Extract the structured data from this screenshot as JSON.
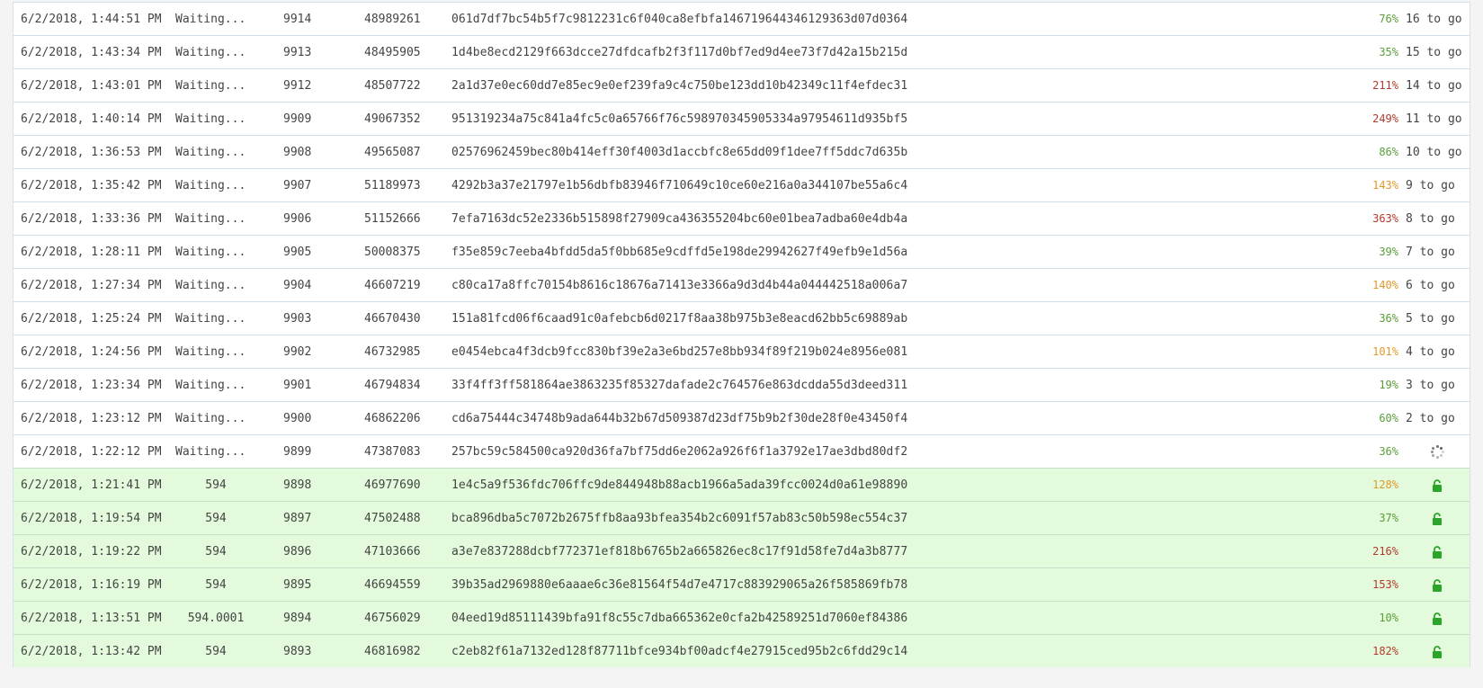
{
  "rows": [
    {
      "time": "6/2/2018, 1:44:51 PM",
      "status": "Waiting...",
      "height": "9914",
      "difficulty": "48989261",
      "hash": "061d7df7bc54b5f7c9812231c6f040ca8efbfa146719644346129363d07d0364",
      "effort": "76%",
      "effort_level": "green",
      "eta": "16 to go",
      "state": "waiting"
    },
    {
      "time": "6/2/2018, 1:43:34 PM",
      "status": "Waiting...",
      "height": "9913",
      "difficulty": "48495905",
      "hash": "1d4be8ecd2129f663dcce27dfdcafb2f3f117d0bf7ed9d4ee73f7d42a15b215d",
      "effort": "35%",
      "effort_level": "green",
      "eta": "15 to go",
      "state": "waiting"
    },
    {
      "time": "6/2/2018, 1:43:01 PM",
      "status": "Waiting...",
      "height": "9912",
      "difficulty": "48507722",
      "hash": "2a1d37e0ec60dd7e85ec9e0ef239fa9c4c750be123dd10b42349c11f4efdec31",
      "effort": "211%",
      "effort_level": "red",
      "eta": "14 to go",
      "state": "waiting"
    },
    {
      "time": "6/2/2018, 1:40:14 PM",
      "status": "Waiting...",
      "height": "9909",
      "difficulty": "49067352",
      "hash": "951319234a75c841a4fc5c0a65766f76c598970345905334a97954611d935bf5",
      "effort": "249%",
      "effort_level": "red",
      "eta": "11 to go",
      "state": "waiting"
    },
    {
      "time": "6/2/2018, 1:36:53 PM",
      "status": "Waiting...",
      "height": "9908",
      "difficulty": "49565087",
      "hash": "02576962459bec80b414eff30f4003d1accbfc8e65dd09f1dee7ff5ddc7d635b",
      "effort": "86%",
      "effort_level": "green",
      "eta": "10 to go",
      "state": "waiting"
    },
    {
      "time": "6/2/2018, 1:35:42 PM",
      "status": "Waiting...",
      "height": "9907",
      "difficulty": "51189973",
      "hash": "4292b3a37e21797e1b56dbfb83946f710649c10ce60e216a0a344107be55a6c4",
      "effort": "143%",
      "effort_level": "orange",
      "eta": "9 to go",
      "state": "waiting"
    },
    {
      "time": "6/2/2018, 1:33:36 PM",
      "status": "Waiting...",
      "height": "9906",
      "difficulty": "51152666",
      "hash": "7efa7163dc52e2336b515898f27909ca436355204bc60e01bea7adba60e4db4a",
      "effort": "363%",
      "effort_level": "red",
      "eta": "8 to go",
      "state": "waiting"
    },
    {
      "time": "6/2/2018, 1:28:11 PM",
      "status": "Waiting...",
      "height": "9905",
      "difficulty": "50008375",
      "hash": "f35e859c7eeba4bfdd5da5f0bb685e9cdffd5e198de29942627f49efb9e1d56a",
      "effort": "39%",
      "effort_level": "green",
      "eta": "7 to go",
      "state": "waiting"
    },
    {
      "time": "6/2/2018, 1:27:34 PM",
      "status": "Waiting...",
      "height": "9904",
      "difficulty": "46607219",
      "hash": "c80ca17a8ffc70154b8616c18676a71413e3366a9d3d4b44a044442518a006a7",
      "effort": "140%",
      "effort_level": "orange",
      "eta": "6 to go",
      "state": "waiting"
    },
    {
      "time": "6/2/2018, 1:25:24 PM",
      "status": "Waiting...",
      "height": "9903",
      "difficulty": "46670430",
      "hash": "151a81fcd06f6caad91c0afebcb6d0217f8aa38b975b3e8eacd62bb5c69889ab",
      "effort": "36%",
      "effort_level": "green",
      "eta": "5 to go",
      "state": "waiting"
    },
    {
      "time": "6/2/2018, 1:24:56 PM",
      "status": "Waiting...",
      "height": "9902",
      "difficulty": "46732985",
      "hash": "e0454ebca4f3dcb9fcc830bf39e2a3e6bd257e8bb934f89f219b024e8956e081",
      "effort": "101%",
      "effort_level": "orange",
      "eta": "4 to go",
      "state": "waiting"
    },
    {
      "time": "6/2/2018, 1:23:34 PM",
      "status": "Waiting...",
      "height": "9901",
      "difficulty": "46794834",
      "hash": "33f4ff3ff581864ae3863235f85327dafade2c764576e863dcdda55d3deed311",
      "effort": "19%",
      "effort_level": "green",
      "eta": "3 to go",
      "state": "waiting"
    },
    {
      "time": "6/2/2018, 1:23:12 PM",
      "status": "Waiting...",
      "height": "9900",
      "difficulty": "46862206",
      "hash": "cd6a75444c34748b9ada644b32b67d509387d23df75b9b2f30de28f0e43450f4",
      "effort": "60%",
      "effort_level": "green",
      "eta": "2 to go",
      "state": "waiting"
    },
    {
      "time": "6/2/2018, 1:22:12 PM",
      "status": "Waiting...",
      "height": "9899",
      "difficulty": "47387083",
      "hash": "257bc59c584500ca920d36fa7bf75dd6e2062a926f6f1a3792e17ae3dbd80df2",
      "effort": "36%",
      "effort_level": "green",
      "eta": "",
      "state": "spinner",
      "icon": "loading-spinner-icon"
    },
    {
      "time": "6/2/2018, 1:21:41 PM",
      "status": "594",
      "height": "9898",
      "difficulty": "46977690",
      "hash": "1e4c5a9f536fdc706ffc9de844948b88acb1966a5ada39fcc0024d0a61e98890",
      "effort": "128%",
      "effort_level": "orange",
      "eta": "",
      "state": "unlocked",
      "icon": "unlock-icon"
    },
    {
      "time": "6/2/2018, 1:19:54 PM",
      "status": "594",
      "height": "9897",
      "difficulty": "47502488",
      "hash": "bca896dba5c7072b2675ffb8aa93bfea354b2c6091f57ab83c50b598ec554c37",
      "effort": "37%",
      "effort_level": "green",
      "eta": "",
      "state": "unlocked",
      "icon": "unlock-icon"
    },
    {
      "time": "6/2/2018, 1:19:22 PM",
      "status": "594",
      "height": "9896",
      "difficulty": "47103666",
      "hash": "a3e7e837288dcbf772371ef818b6765b2a665826ec8c17f91d58fe7d4a3b8777",
      "effort": "216%",
      "effort_level": "red",
      "eta": "",
      "state": "unlocked",
      "icon": "unlock-icon"
    },
    {
      "time": "6/2/2018, 1:16:19 PM",
      "status": "594",
      "height": "9895",
      "difficulty": "46694559",
      "hash": "39b35ad2969880e6aaae6c36e81564f54d7e4717c883929065a26f585869fb78",
      "effort": "153%",
      "effort_level": "red",
      "eta": "",
      "state": "unlocked",
      "icon": "unlock-icon"
    },
    {
      "time": "6/2/2018, 1:13:51 PM",
      "status": "594.0001",
      "height": "9894",
      "difficulty": "46756029",
      "hash": "04eed19d85111439bfa91f8c55c7dba665362e0cfa2b42589251d7060ef84386",
      "effort": "10%",
      "effort_level": "green",
      "eta": "",
      "state": "unlocked",
      "icon": "unlock-icon"
    },
    {
      "time": "6/2/2018, 1:13:42 PM",
      "status": "594",
      "height": "9893",
      "difficulty": "46816982",
      "hash": "c2eb82f61a7132ed128f87711bfce934bf00adcf4e27915ced95b2c6fdd29c14",
      "effort": "182%",
      "effort_level": "red",
      "eta": "",
      "state": "unlocked",
      "icon": "unlock-icon"
    }
  ],
  "colors": {
    "green": "#5a9e3a",
    "orange": "#e09a2a",
    "red": "#b33a2a",
    "unlocked_row": "#e3fbdc",
    "lock_icon": "#2aa52a"
  }
}
